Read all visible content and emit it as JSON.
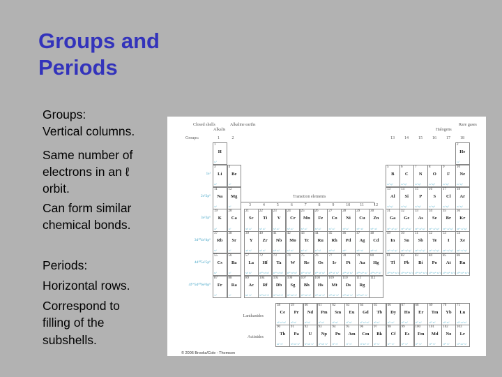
{
  "slide": {
    "title_line1": "Groups and",
    "title_line2": "Periods",
    "groups_heading": "Groups",
    "groups_colon": ":",
    "groups_lines": [
      "Vertical columns.",
      "Same number of",
      "electrons in an ℓ",
      "orbit.",
      "Can form similar",
      "chemical bonds."
    ],
    "periods_heading": "Periods",
    "periods_colon": ":",
    "periods_lines": [
      "Horizontal rows.",
      "Correspond to",
      "filling of the",
      "subshells."
    ]
  },
  "colors": {
    "background": "#b2b2b2",
    "title": "#3333bb",
    "config_text": "#4aa8c8"
  },
  "table": {
    "header": {
      "closed_shells": "Closed shells",
      "alkalis": "Alkalis",
      "alkaline_earths": "Alkaline earths",
      "halogens": "Halogens",
      "rare_gases": "Rare gases",
      "groups_label": "Groups:",
      "transition_elements": "Transition elements",
      "lanthanides": "Lanthanides",
      "actinides": "Actinides"
    },
    "group_numbers": [
      "1",
      "2",
      "3",
      "4",
      "5",
      "6",
      "7",
      "8",
      "9",
      "10",
      "11",
      "12",
      "13",
      "14",
      "15",
      "16",
      "17",
      "18"
    ],
    "core_configs": [
      "1s²",
      "2s²2p⁶",
      "3s²3p⁶",
      "3d¹⁰4s²4p⁶",
      "4d¹⁰5s²5p⁶",
      "4f¹⁴5d¹⁰6s²6p⁶"
    ],
    "elements": [
      [
        1,
        "H",
        "1s¹",
        1,
        1
      ],
      [
        2,
        "He",
        "1s²",
        18,
        1
      ],
      [
        3,
        "Li",
        "2s¹",
        1,
        2
      ],
      [
        4,
        "Be",
        "2s²",
        2,
        2
      ],
      [
        5,
        "B",
        "2s² 2p¹",
        13,
        2
      ],
      [
        6,
        "C",
        "2s² 2p²",
        14,
        2
      ],
      [
        7,
        "N",
        "2s² 2p³",
        15,
        2
      ],
      [
        8,
        "O",
        "2s² 2p⁴",
        16,
        2
      ],
      [
        9,
        "F",
        "2s² 2p⁵",
        17,
        2
      ],
      [
        10,
        "Ne",
        "2s² 2p⁶",
        18,
        2
      ],
      [
        11,
        "Na",
        "3s¹",
        1,
        3
      ],
      [
        12,
        "Mg",
        "3s²",
        2,
        3
      ],
      [
        13,
        "Al",
        "3s² 3p¹",
        13,
        3
      ],
      [
        14,
        "Si",
        "3s² 3p²",
        14,
        3
      ],
      [
        15,
        "P",
        "3s² 3p³",
        15,
        3
      ],
      [
        16,
        "S",
        "3s² 3p⁴",
        16,
        3
      ],
      [
        17,
        "Cl",
        "3s² 3p⁵",
        17,
        3
      ],
      [
        18,
        "Ar",
        "3s² 3p⁶",
        18,
        3
      ],
      [
        19,
        "K",
        "4s¹",
        1,
        4
      ],
      [
        20,
        "Ca",
        "4s²",
        2,
        4
      ],
      [
        21,
        "Sc",
        "3d¹ 4s²",
        3,
        4
      ],
      [
        22,
        "Ti",
        "3d² 4s²",
        4,
        4
      ],
      [
        23,
        "V",
        "3d³ 4s²",
        5,
        4
      ],
      [
        24,
        "Cr",
        "3d⁵ 4s¹",
        6,
        4
      ],
      [
        25,
        "Mn",
        "3d⁵ 4s²",
        7,
        4
      ],
      [
        26,
        "Fe",
        "3d⁶ 4s²",
        8,
        4
      ],
      [
        27,
        "Co",
        "3d⁷ 4s²",
        9,
        4
      ],
      [
        28,
        "Ni",
        "3d⁸ 4s²",
        10,
        4
      ],
      [
        29,
        "Cu",
        "3d¹⁰ 4s¹",
        11,
        4
      ],
      [
        30,
        "Zn",
        "3d¹⁰ 4s²",
        12,
        4
      ],
      [
        31,
        "Ga",
        "3d¹⁰ 4s² 4p¹",
        13,
        4
      ],
      [
        32,
        "Ge",
        "3d¹⁰ 4s² 4p²",
        14,
        4
      ],
      [
        33,
        "As",
        "3d¹⁰ 4s² 4p³",
        15,
        4
      ],
      [
        34,
        "Se",
        "3d¹⁰ 4s² 4p⁴",
        16,
        4
      ],
      [
        35,
        "Br",
        "3d¹⁰ 4s² 4p⁵",
        17,
        4
      ],
      [
        36,
        "Kr",
        "3d¹⁰ 4s² 4p⁶",
        18,
        4
      ],
      [
        37,
        "Rb",
        "5s¹",
        1,
        5
      ],
      [
        38,
        "Sr",
        "5s²",
        2,
        5
      ],
      [
        39,
        "Y",
        "4d¹ 5s²",
        3,
        5
      ],
      [
        40,
        "Zr",
        "4d² 5s²",
        4,
        5
      ],
      [
        41,
        "Nb",
        "4d⁴ 5s¹",
        5,
        5
      ],
      [
        42,
        "Mo",
        "4d⁵ 5s¹",
        6,
        5
      ],
      [
        43,
        "Tc",
        "4d⁵ 5s²",
        7,
        5
      ],
      [
        44,
        "Ru",
        "4d⁷ 5s¹",
        8,
        5
      ],
      [
        45,
        "Rh",
        "4d⁸ 5s¹",
        9,
        5
      ],
      [
        46,
        "Pd",
        "4d¹⁰",
        10,
        5
      ],
      [
        47,
        "Ag",
        "4d¹⁰ 5s¹",
        11,
        5
      ],
      [
        48,
        "Cd",
        "4d¹⁰ 5s²",
        12,
        5
      ],
      [
        49,
        "In",
        "4d¹⁰ 5s² 5p¹",
        13,
        5
      ],
      [
        50,
        "Sn",
        "4d¹⁰ 5s² 5p²",
        14,
        5
      ],
      [
        51,
        "Sb",
        "4d¹⁰ 5s² 5p³",
        15,
        5
      ],
      [
        52,
        "Te",
        "4d¹⁰ 5s² 5p⁴",
        16,
        5
      ],
      [
        53,
        "I",
        "4d¹⁰ 5s² 5p⁵",
        17,
        5
      ],
      [
        54,
        "Xe",
        "4d¹⁰ 5s² 5p⁶",
        18,
        5
      ],
      [
        55,
        "Cs",
        "6s¹",
        1,
        6
      ],
      [
        56,
        "Ba",
        "6s²",
        2,
        6
      ],
      [
        57,
        "La",
        "5d¹ 6s²",
        3,
        6
      ],
      [
        72,
        "Hf",
        "4f¹⁴ 5d² 6s²",
        4,
        6
      ],
      [
        73,
        "Ta",
        "4f¹⁴ 5d³ 6s²",
        5,
        6
      ],
      [
        74,
        "W",
        "4f¹⁴ 5d⁴ 6s²",
        6,
        6
      ],
      [
        75,
        "Re",
        "4f¹⁴ 5d⁵ 6s²",
        7,
        6
      ],
      [
        76,
        "Os",
        "4f¹⁴ 5d⁶ 6s²",
        8,
        6
      ],
      [
        77,
        "Ir",
        "4f¹⁴ 5d⁷ 6s²",
        9,
        6
      ],
      [
        78,
        "Pt",
        "4f¹⁴ 5d⁹ 6s¹",
        10,
        6
      ],
      [
        79,
        "Au",
        "4f¹⁴ 5d¹⁰ 6s¹",
        11,
        6
      ],
      [
        80,
        "Hg",
        "4f¹⁴ 5d¹⁰ 6s²",
        12,
        6
      ],
      [
        81,
        "Tl",
        "4f¹⁴ 5d¹⁰ 6s² 6p¹",
        13,
        6
      ],
      [
        82,
        "Pb",
        "4f¹⁴ 5d¹⁰ 6s² 6p²",
        14,
        6
      ],
      [
        83,
        "Bi",
        "4f¹⁴ 5d¹⁰ 6s² 6p³",
        15,
        6
      ],
      [
        84,
        "Po",
        "4f¹⁴ 5d¹⁰ 6s² 6p⁴",
        16,
        6
      ],
      [
        85,
        "At",
        "4f¹⁴ 5d¹⁰ 6s² 6p⁵",
        17,
        6
      ],
      [
        86,
        "Rn",
        "4f¹⁴ 5d¹⁰ 6s² 6p⁶",
        18,
        6
      ],
      [
        87,
        "Fr",
        "7s¹",
        1,
        7
      ],
      [
        88,
        "Ra",
        "7s²",
        2,
        7
      ],
      [
        89,
        "Ac",
        "6d¹ 7s²",
        3,
        7
      ],
      [
        104,
        "Rf",
        "5f¹⁴ 6d² 7s²",
        4,
        7
      ],
      [
        105,
        "Db",
        "5f¹⁴ 6d³ 7s²",
        5,
        7
      ],
      [
        106,
        "Sg",
        "5f¹⁴ 6d⁴ 7s²",
        6,
        7
      ],
      [
        107,
        "Bh",
        "5f¹⁴ 6d⁵ 7s²",
        7,
        7
      ],
      [
        108,
        "Hs",
        "5f¹⁴ 6d⁶ 7s²",
        8,
        7
      ],
      [
        109,
        "Mt",
        "5f¹⁴ 6d⁷ 7s²",
        9,
        7
      ],
      [
        110,
        "Ds",
        "5f¹⁴ 6d⁹ 7s¹",
        10,
        7
      ],
      [
        111,
        "Rg",
        "5f¹⁴ 6d¹⁰ 7s¹",
        11,
        7
      ],
      [
        112,
        "",
        "",
        12,
        7
      ]
    ],
    "lanthanides": [
      [
        58,
        "Ce",
        "4f¹ 5d¹ 6s²"
      ],
      [
        59,
        "Pr",
        "4f³ 6s²"
      ],
      [
        60,
        "Nd",
        "4f⁴ 6s²"
      ],
      [
        61,
        "Pm",
        "4f⁵ 6s²"
      ],
      [
        62,
        "Sm",
        "4f⁶ 6s²"
      ],
      [
        63,
        "Eu",
        "4f⁷ 6s²"
      ],
      [
        64,
        "Gd",
        "4f⁷ 5d¹ 6s²"
      ],
      [
        65,
        "Tb",
        "4f⁹ 6s²"
      ],
      [
        66,
        "Dy",
        "4f¹⁰ 6s²"
      ],
      [
        67,
        "Ho",
        "4f¹¹ 6s²"
      ],
      [
        68,
        "Er",
        "4f¹² 6s²"
      ],
      [
        69,
        "Tm",
        "4f¹³ 6s²"
      ],
      [
        70,
        "Yb",
        "4f¹⁴ 6s²"
      ],
      [
        71,
        "Lu",
        "4f¹⁴ 5d¹ 6s²"
      ]
    ],
    "actinides": [
      [
        90,
        "Th",
        "6d² 7s²"
      ],
      [
        91,
        "Pa",
        "5f² 6d¹ 7s²"
      ],
      [
        92,
        "U",
        "5f³ 6d¹ 7s²"
      ],
      [
        93,
        "Np",
        "5f⁴ 6d¹ 7s²"
      ],
      [
        94,
        "Pu",
        "5f⁶ 7s²"
      ],
      [
        95,
        "Am",
        "5f⁷ 7s²"
      ],
      [
        96,
        "Cm",
        "5f⁷ 6d¹ 7s²"
      ],
      [
        97,
        "Bk",
        "5f⁹ 7s²"
      ],
      [
        98,
        "Cf",
        "5f¹⁰ 7s²"
      ],
      [
        99,
        "Es",
        "5f¹¹ 7s²"
      ],
      [
        100,
        "Fm",
        "5f¹² 7s²"
      ],
      [
        101,
        "Md",
        "5f¹³ 7s²"
      ],
      [
        102,
        "No",
        "5f¹⁴ 7s²"
      ],
      [
        103,
        "Lr",
        "5f¹⁴ 6d¹ 7s²"
      ]
    ],
    "copyright": "© 2006 Brooks/Cole - Thomson"
  }
}
